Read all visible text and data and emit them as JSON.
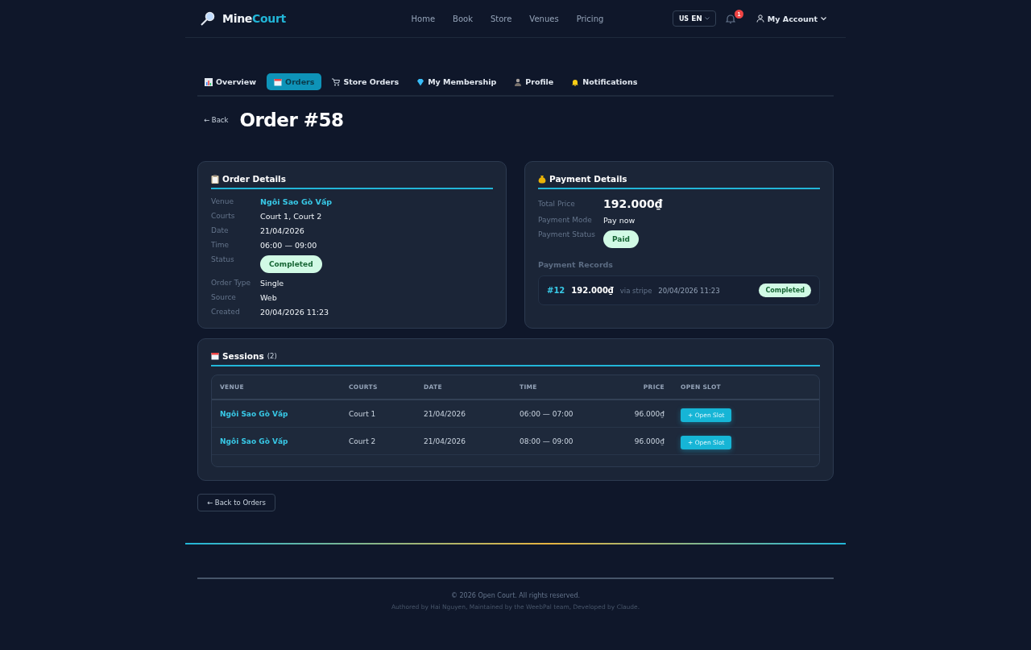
{
  "header": {
    "logo": {
      "first": "Mine",
      "second": "Court"
    },
    "nav": [
      "Home",
      "Book",
      "Store",
      "Venues",
      "Pricing"
    ],
    "language": {
      "flag": "US",
      "code": "EN"
    },
    "notifications": {
      "count": "1"
    },
    "account": "My Account"
  },
  "tabs": [
    {
      "label": "Overview",
      "kind": "chart",
      "selected": false
    },
    {
      "label": "Orders",
      "kind": "calendar",
      "selected": true
    },
    {
      "label": "Store Orders",
      "kind": "cart",
      "selected": false
    },
    {
      "label": "My Membership",
      "kind": "gem",
      "selected": false
    },
    {
      "label": "Profile",
      "kind": "person",
      "selected": false
    },
    {
      "label": "Notifications",
      "kind": "bell",
      "selected": false
    }
  ],
  "back": "← Back",
  "title": "Order #58",
  "order_details": {
    "title": "Order Details",
    "fields": [
      {
        "label": "Venue",
        "value": "Ngôi Sao Gò Vấp",
        "kind": "link"
      },
      {
        "label": "Courts",
        "value": "Court 1, Court 2",
        "kind": "text"
      },
      {
        "label": "Date",
        "value": "21/04/2026",
        "kind": "text"
      },
      {
        "label": "Time",
        "value": "06:00 — 09:00",
        "kind": "text"
      },
      {
        "label": "Status",
        "value": "Completed",
        "kind": "badge"
      },
      {
        "label": "Order Type",
        "value": "Single",
        "kind": "text"
      },
      {
        "label": "Source",
        "value": "Web",
        "kind": "text"
      },
      {
        "label": "Created",
        "value": "20/04/2026 11:23",
        "kind": "text"
      }
    ]
  },
  "payment_details": {
    "title": "Payment Details",
    "fields": [
      {
        "label": "Total Price",
        "value": "192.000₫",
        "kind": "price"
      },
      {
        "label": "Payment Mode",
        "value": "Pay now",
        "kind": "text"
      },
      {
        "label": "Payment Status",
        "value": "Paid",
        "kind": "badge"
      }
    ],
    "records_title": "Payment Records",
    "records": [
      {
        "id": "#12",
        "amount": "192.000₫",
        "method": "via stripe",
        "date": "20/04/2026 11:23",
        "status": "Completed"
      }
    ]
  },
  "sessions": {
    "title": "Sessions",
    "count": "(2)",
    "columns": [
      "VENUE",
      "COURTS",
      "DATE",
      "TIME",
      "PRICE",
      "OPEN SLOT"
    ],
    "rows": [
      {
        "venue": "Ngôi Sao Gò Vấp",
        "court": "Court 1",
        "date": "21/04/2026",
        "time": "06:00 — 07:00",
        "price": "96.000₫",
        "action": "+ Open Slot"
      },
      {
        "venue": "Ngôi Sao Gò Vấp",
        "court": "Court 2",
        "date": "21/04/2026",
        "time": "08:00 — 09:00",
        "price": "96.000₫",
        "action": "+ Open Slot"
      }
    ]
  },
  "back_to_orders": "← Back to Orders",
  "footer": {
    "copyright": "© 2026 Open Court. All rights reserved.",
    "credits": "Authored by Hai Nguyen, Maintained by the WeebPal team, Developed by Claude."
  }
}
